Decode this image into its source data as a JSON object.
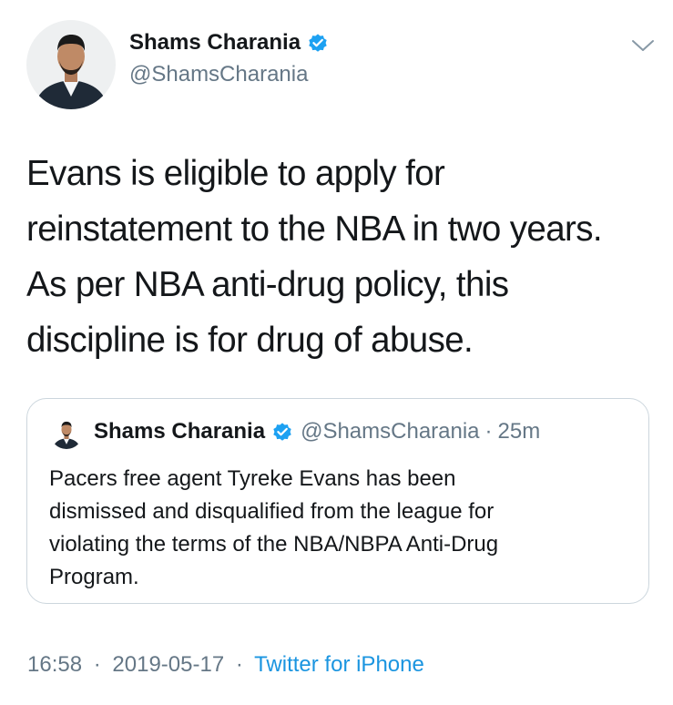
{
  "author": {
    "display_name": "Shams Charania",
    "handle": "@ShamsCharania",
    "verified": true,
    "avatar_icon": "profile-photo"
  },
  "tweet": {
    "text": "Evans is eligible to apply for\nreinstatement to the NBA in two years.\nAs per NBA anti-drug policy, this\ndiscipline is for drug of abuse."
  },
  "quoted_tweet": {
    "display_name": "Shams Charania",
    "handle": "@ShamsCharania",
    "separator": "·",
    "time_ago": "25m",
    "verified": true,
    "text": "Pacers free agent Tyreke Evans has been\ndismissed and disqualified from the league for\nviolating the terms of the NBA/NBPA Anti-Drug\nProgram."
  },
  "footer": {
    "time": "16:58",
    "separator": "·",
    "date": "2019-05-17",
    "source": "Twitter for iPhone"
  },
  "colors": {
    "text": "#14171a",
    "secondary": "#657786",
    "link": "#1b95e0",
    "verified": "#1da1f2",
    "border": "#ccd6dd"
  },
  "icons": {
    "verified": "verified-badge-icon",
    "menu": "chevron-down-icon"
  }
}
